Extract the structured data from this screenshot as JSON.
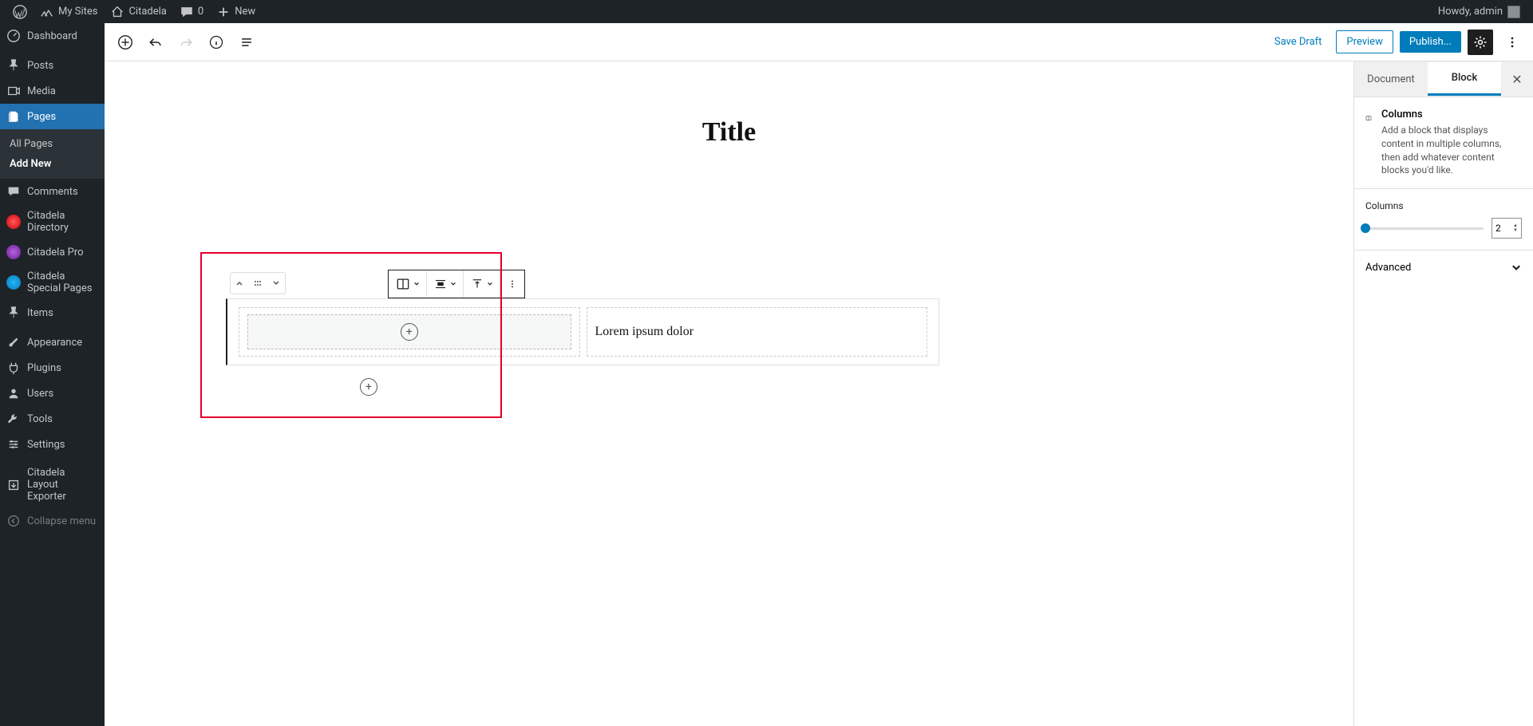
{
  "adminbar": {
    "my_sites": "My Sites",
    "site_name": "Citadela",
    "comments": "0",
    "new": "New",
    "greeting": "Howdy, admin"
  },
  "sidebar": {
    "dashboard": "Dashboard",
    "posts": "Posts",
    "media": "Media",
    "pages": "Pages",
    "pages_sub": {
      "all": "All Pages",
      "add": "Add New"
    },
    "comments": "Comments",
    "citadela_dir": "Citadela Directory",
    "citadela_pro": "Citadela Pro",
    "citadela_special": "Citadela Special Pages",
    "items": "Items",
    "appearance": "Appearance",
    "plugins": "Plugins",
    "users": "Users",
    "tools": "Tools",
    "settings": "Settings",
    "citadela_layout": "Citadela Layout Exporter",
    "collapse": "Collapse menu"
  },
  "header": {
    "save_draft": "Save Draft",
    "preview": "Preview",
    "publish": "Publish..."
  },
  "canvas": {
    "title": "Title",
    "col_text": "Lorem ipsum dolor"
  },
  "panel": {
    "tab_document": "Document",
    "tab_block": "Block",
    "block_title": "Columns",
    "block_desc": "Add a block that displays content in multiple columns, then add whatever content blocks you'd like.",
    "columns_label": "Columns",
    "columns_value": "2",
    "advanced": "Advanced"
  }
}
